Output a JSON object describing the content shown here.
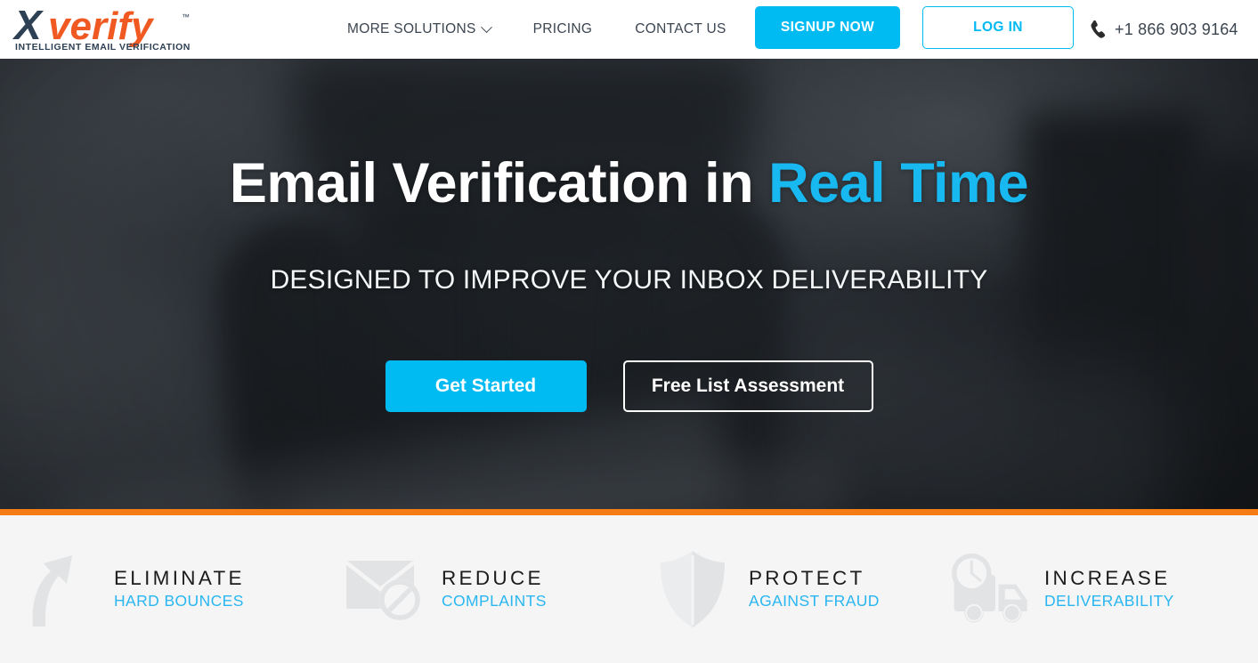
{
  "brand": {
    "logo_x": "X",
    "logo_name": "verify",
    "logo_tm": "™",
    "logo_tagline": "INTELLIGENT EMAIL VERIFICATION",
    "colors": {
      "navy": "#2E4054",
      "orange": "#F05A22",
      "cyan": "#00BAF2",
      "divider_orange": "#F57C14",
      "feature_gray": "#F5F5F5",
      "icon_gray": "#E2E3E5"
    }
  },
  "header": {
    "nav": [
      {
        "label": "MORE SOLUTIONS",
        "has_dropdown": true,
        "icon": "chevron-down-icon"
      },
      {
        "label": "PRICING",
        "has_dropdown": false
      },
      {
        "label": "CONTACT US",
        "has_dropdown": false
      }
    ],
    "signup_label": "SIGNUP NOW",
    "login_label": "LOG IN",
    "phone_icon": "phone-icon",
    "phone_number": "+1 866 903 9164"
  },
  "hero": {
    "title_main": "Email Verification in ",
    "title_accent": "Real Time",
    "subtitle": "DESIGNED TO IMPROVE YOUR INBOX DELIVERABILITY",
    "cta_primary": "Get Started",
    "cta_secondary": "Free List Assessment"
  },
  "features": [
    {
      "icon": "upward-arrow-icon",
      "title": "ELIMINATE",
      "subtitle": "HARD BOUNCES"
    },
    {
      "icon": "envelope-blocked-icon",
      "title": "REDUCE",
      "subtitle": "COMPLAINTS"
    },
    {
      "icon": "shield-icon",
      "title": "PROTECT",
      "subtitle": "AGAINST FRAUD"
    },
    {
      "icon": "delivery-truck-clock-icon",
      "title": "INCREASE",
      "subtitle": "DELIVERABILITY"
    }
  ]
}
